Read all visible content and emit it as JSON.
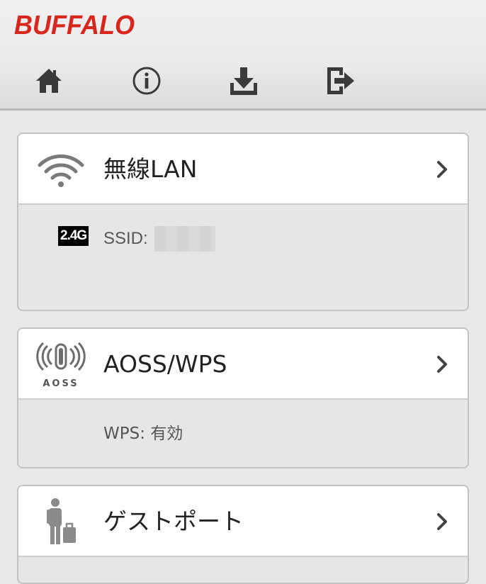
{
  "header": {
    "logo_text": "BUFFALO",
    "brand_color": "#d7261e",
    "nav": [
      {
        "icon": "home-icon"
      },
      {
        "icon": "info-icon"
      },
      {
        "icon": "download-icon"
      },
      {
        "icon": "logout-icon"
      }
    ]
  },
  "cards": {
    "wireless": {
      "title": "無線LAN",
      "icon": "wifi-icon",
      "band_badge": "2.4G",
      "ssid_label": "SSID:",
      "ssid_value": ""
    },
    "aoss": {
      "title": "AOSS/WPS",
      "icon": "aoss-icon",
      "icon_label": "AOSS",
      "wps_status": "WPS: 有効"
    },
    "guest": {
      "title": "ゲストポート",
      "icon": "guest-icon"
    }
  }
}
